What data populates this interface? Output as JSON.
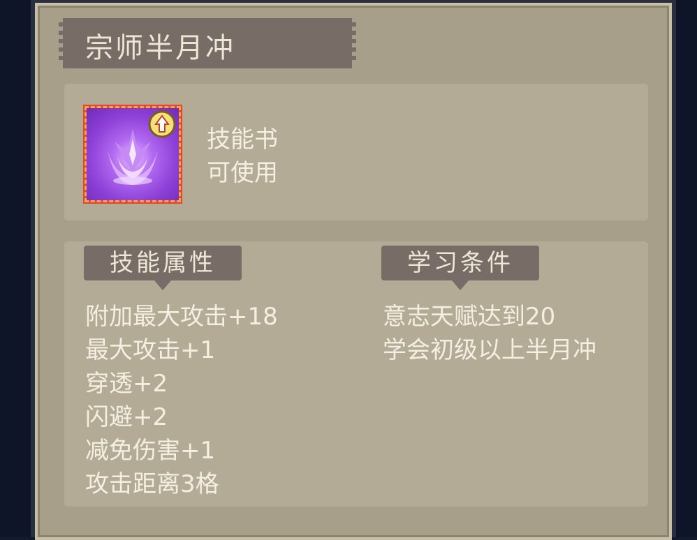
{
  "skill": {
    "title": "宗师半月冲",
    "item_type": "技能书",
    "usable_status": "可使用",
    "icon": "crescent-slash-skill-icon",
    "badge_icon": "upgrade-arrow-icon"
  },
  "sections": {
    "attributes": {
      "label": "技能属性",
      "items": [
        "附加最大攻击+18",
        "最大攻击+1",
        "穿透+2",
        "闪避+2",
        "减免伤害+1",
        "攻击距离3格"
      ]
    },
    "requirements": {
      "label": "学习条件",
      "items": [
        "意志天赋达到20",
        "学会初级以上半月冲"
      ]
    }
  },
  "colors": {
    "panel": "#a89f8a",
    "banner": "#776c66",
    "icon_border": "#e8432c",
    "text": "#f4efe2"
  }
}
